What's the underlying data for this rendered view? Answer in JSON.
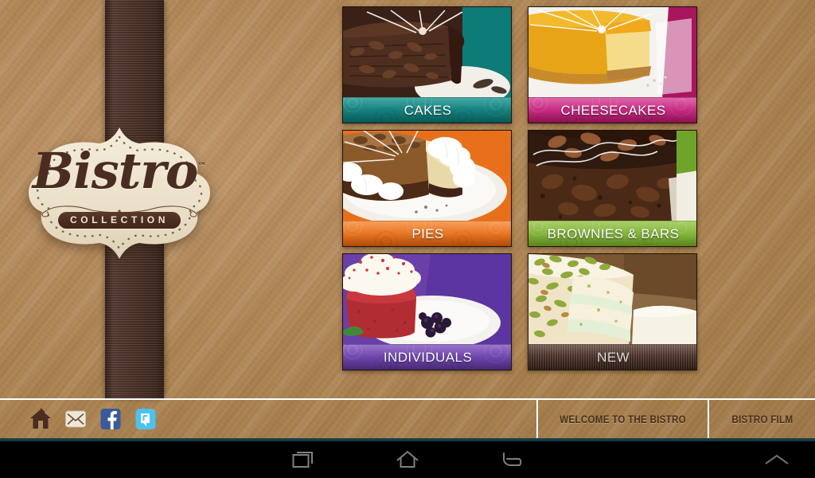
{
  "app": {
    "title": "Bistro Collection",
    "brand_name": "Bistro",
    "brand_tm": "™",
    "brand_sub": "COLLECTION",
    "colors": {
      "kraft": "#b1885c",
      "ribbon": "#4d3126",
      "badge_cream": "#efe6d2",
      "badge_ink": "#4a2c21",
      "footer_text": "#4c3119",
      "teal_strip": "#1c4450",
      "navbar": "#000000"
    }
  },
  "tiles": [
    {
      "label": "CAKES",
      "bar_color": "#0d7b78",
      "bar_color_2": "#0a6360",
      "accent": "#0d7b78",
      "photo_kind": "chocolate-cake",
      "bar_texture": "swirl",
      "position": "row0-col0"
    },
    {
      "label": "CHEESECAKES",
      "bar_color": "#c4227d",
      "bar_color_2": "#a4155f",
      "accent": "#c4227d",
      "photo_kind": "orange-cheesecake",
      "bar_texture": "swirl",
      "position": "row0-col1"
    },
    {
      "label": "PIES",
      "bar_color": "#e8701a",
      "bar_color_2": "#d45b0d",
      "accent": "#e8701a",
      "photo_kind": "cream-pie",
      "bar_texture": "swirl",
      "position": "row1-col0"
    },
    {
      "label": "BROWNIES & BARS",
      "bar_color": "#7fb335",
      "bar_color_2": "#69a025",
      "accent": "#7fb335",
      "photo_kind": "brownie",
      "bar_texture": "swirl",
      "position": "row1-col1"
    },
    {
      "label": "INDIVIDUALS",
      "bar_color": "#6a3fa8",
      "bar_color_2": "#55308c",
      "accent": "#6a3fa8",
      "photo_kind": "red-velvet-individual",
      "bar_texture": "swirl",
      "position": "row2-col0"
    },
    {
      "label": "NEW",
      "bar_color": "#4d3126",
      "bar_color_2": "#3c251c",
      "accent": "#4d3126",
      "photo_kind": "pistachio-cake",
      "bar_texture": "stripes",
      "position": "row2-col1"
    }
  ],
  "footer": {
    "icons": [
      {
        "name": "home-icon",
        "label": "Home"
      },
      {
        "name": "email-icon",
        "label": "Email"
      },
      {
        "name": "facebook-icon",
        "label": "Facebook"
      },
      {
        "name": "twitter-icon",
        "label": "Twitter"
      }
    ],
    "buttons": [
      {
        "label": "WELCOME TO THE BISTRO"
      },
      {
        "label": "BISTRO FILM"
      }
    ]
  },
  "navbar": {
    "buttons": [
      {
        "name": "recents-icon",
        "label": "Recents"
      },
      {
        "name": "home-icon",
        "label": "Home"
      },
      {
        "name": "back-icon",
        "label": "Back"
      },
      {
        "name": "expand-icon",
        "label": "Expand"
      }
    ]
  }
}
